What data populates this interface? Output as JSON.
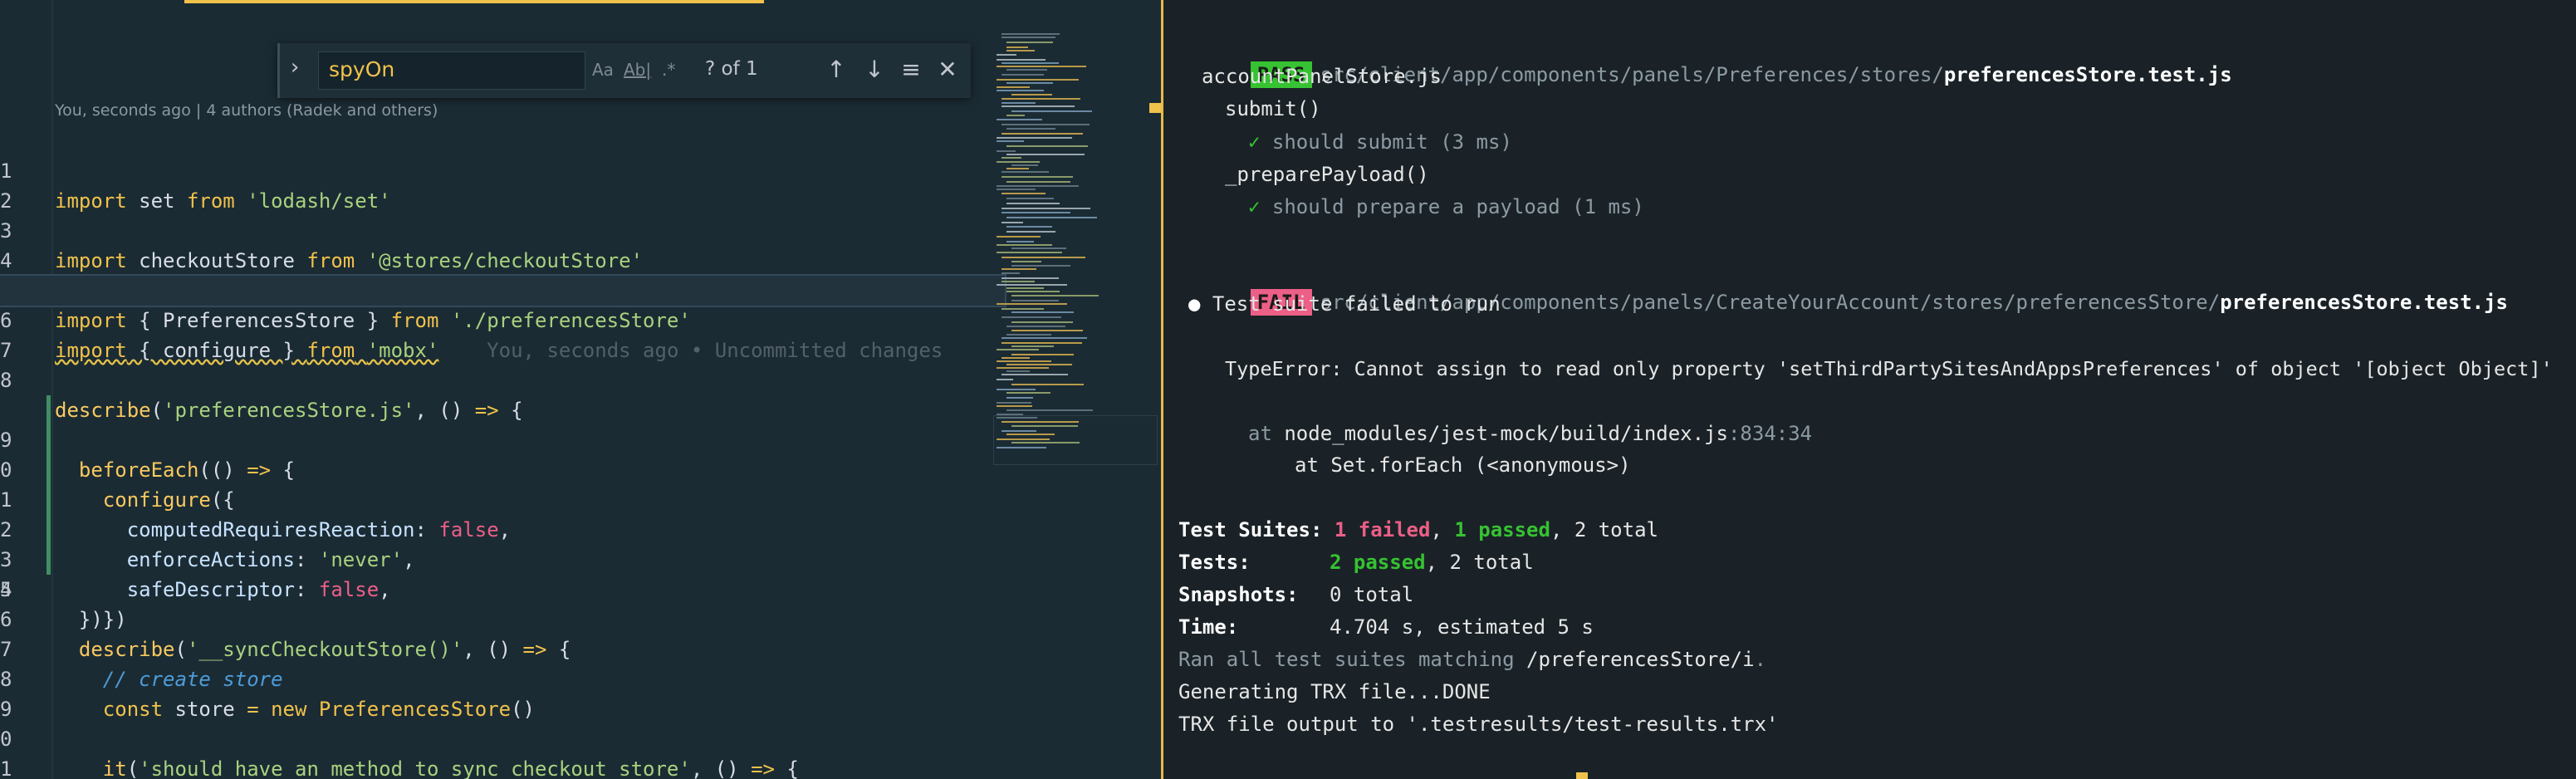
{
  "editor": {
    "codelens": "You, seconds ago | 4 authors (Radek and others)",
    "find": {
      "query": "spyOn",
      "match_case_label": "Aa",
      "whole_word_label": "Ab|",
      "regex_label": ".*",
      "count": "? of 1"
    },
    "line_numbers": [
      "1",
      "2",
      "3",
      "4",
      "5",
      "6",
      "7",
      "8",
      "9",
      "0",
      "1",
      "2",
      "3",
      "4",
      "5",
      "6",
      "7",
      "8",
      "9",
      "0",
      "1"
    ],
    "current_line_blame": "You, seconds ago • Uncommitted changes"
  },
  "terminal": {
    "pass_badge": "PASS",
    "pass_path_dim": "src/client/app/components/panels/Preferences/stores/",
    "pass_path_file": "preferencesStore.test.js",
    "suite_name": "accountPanelStore.js",
    "group1": "submit()",
    "test1": "should submit (3 ms)",
    "group2": "_preparePayload()",
    "test2": "should prepare a payload (1 ms)",
    "fail_badge": "FAIL",
    "fail_path_dim": "src/client/app/components/panels/CreateYourAccount/stores/preferencesStore/",
    "fail_path_file": "preferencesStore.test.js",
    "bullet_msg": "Test suite failed to run",
    "error": "TypeError: Cannot assign to read only property 'setThirdPartySitesAndAppsPreferences' of object '[object Object]'",
    "at1_prefix": "at",
    "at1_path": "node_modules/jest-mock/build/index.js",
    "at1_loc": ":834:34",
    "at2": "at Set.forEach (<anonymous>)",
    "suites_label": "Test Suites:",
    "suites_failed": "1 failed",
    "suites_passed": "1 passed",
    "suites_total": ", 2 total",
    "tests_label": "Tests:",
    "tests_passed": "2 passed",
    "tests_total": ", 2 total",
    "snapshots_label": "Snapshots:",
    "snapshots_value": "0 total",
    "time_label": "Time:",
    "time_value": "4.704 s, estimated 5 s",
    "ran_prefix": "Ran all test suites matching",
    "ran_pattern": "/preferencesStore/i",
    "ran_suffix": ".",
    "trx1": "Generating TRX file...DONE",
    "trx2": "TRX file output to '.testresults/test-results.trx'"
  },
  "colors": {
    "editor_bg": "#1b2b34",
    "terminal_bg": "#1a2227",
    "accent": "#f0c24b",
    "pass": "#36c232",
    "fail": "#ec5f87"
  }
}
